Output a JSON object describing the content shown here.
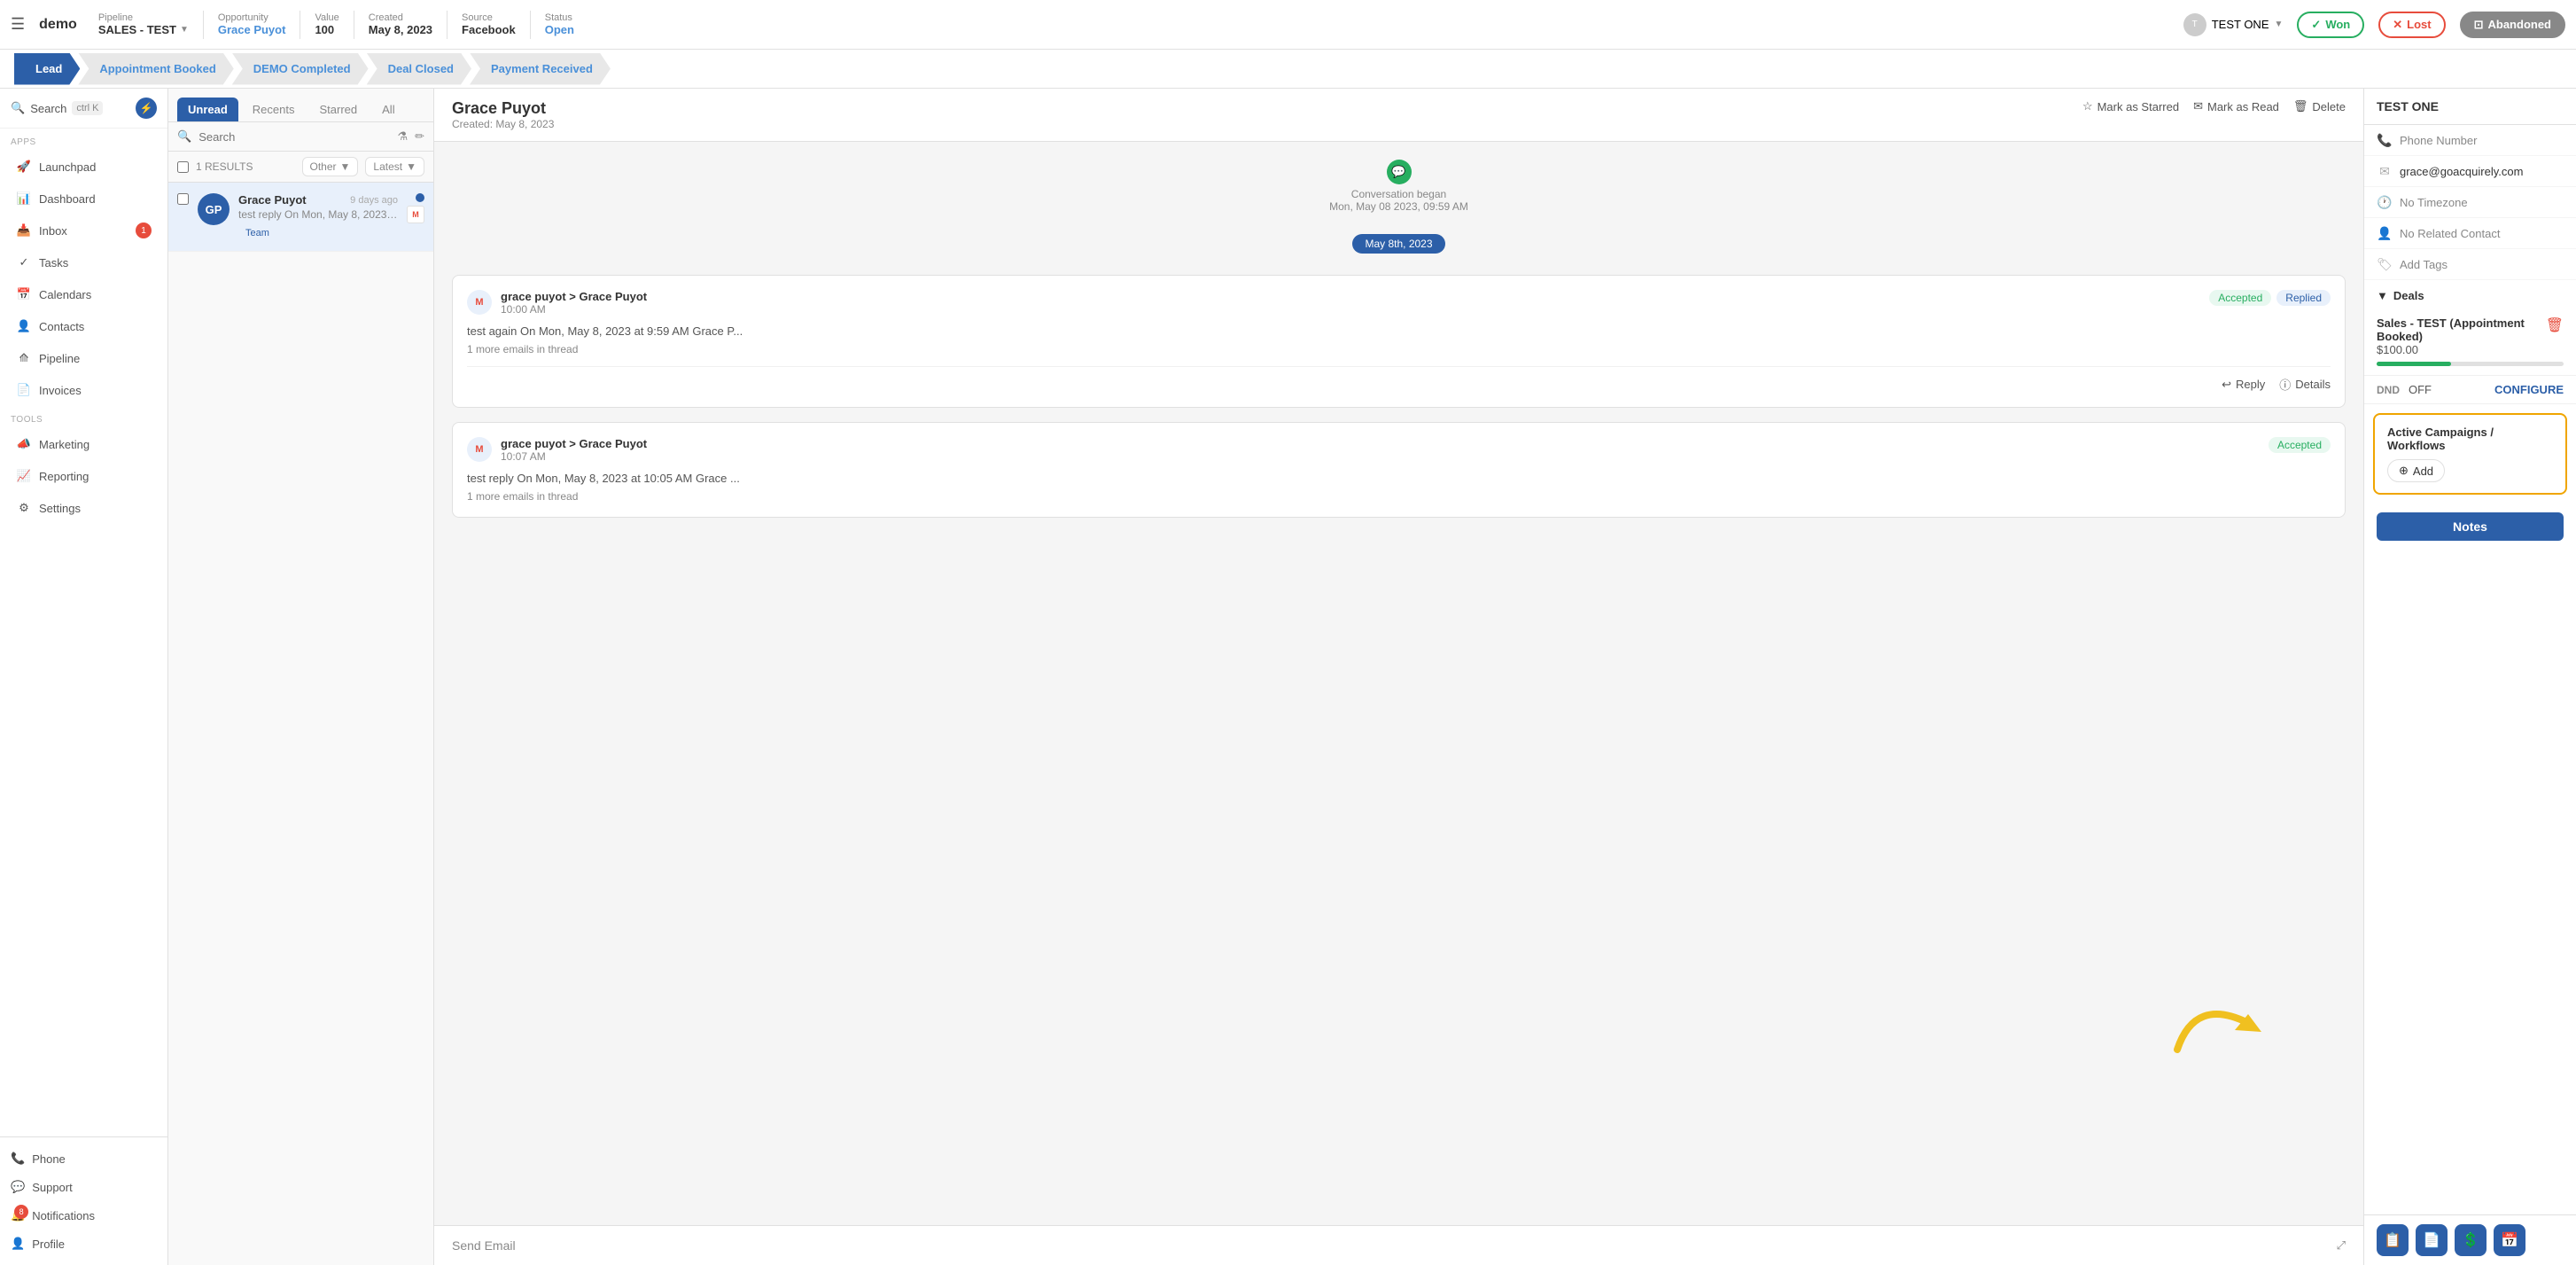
{
  "app": {
    "logo": "demo",
    "hamburger": "☰"
  },
  "topbar": {
    "pipeline_label": "Pipeline",
    "pipeline_value": "SALES - TEST",
    "opportunity_label": "Opportunity",
    "opportunity_value": "Grace Puyot",
    "value_label": "Value",
    "value_value": "100",
    "created_label": "Created",
    "created_value": "May 8, 2023",
    "source_label": "Source",
    "source_value": "Facebook",
    "status_label": "Status",
    "status_value": "Open",
    "user_name": "TEST ONE",
    "won_label": "Won",
    "lost_label": "Lost",
    "abandoned_label": "Abandoned"
  },
  "stages": [
    {
      "label": "Lead",
      "active": true
    },
    {
      "label": "Appointment Booked",
      "active": false
    },
    {
      "label": "DEMO Completed",
      "active": false
    },
    {
      "label": "Deal Closed",
      "active": false
    },
    {
      "label": "Payment Received",
      "active": false
    }
  ],
  "sidebar": {
    "search_label": "Search",
    "search_shortcut": "ctrl K",
    "sections": [
      {
        "label": "Apps",
        "items": [
          {
            "icon": "🚀",
            "label": "Launchpad"
          },
          {
            "icon": "📊",
            "label": "Dashboard"
          },
          {
            "icon": "📥",
            "label": "Inbox",
            "badge": "1"
          },
          {
            "icon": "✓",
            "label": "Tasks"
          },
          {
            "icon": "📅",
            "label": "Calendars"
          },
          {
            "icon": "👤",
            "label": "Contacts"
          },
          {
            "icon": "⟰",
            "label": "Pipeline"
          },
          {
            "icon": "📄",
            "label": "Invoices"
          }
        ]
      },
      {
        "label": "Tools",
        "items": [
          {
            "icon": "📣",
            "label": "Marketing"
          },
          {
            "icon": "📈",
            "label": "Reporting"
          },
          {
            "icon": "⚙",
            "label": "Settings"
          }
        ]
      }
    ],
    "bottom_items": [
      {
        "icon": "📞",
        "label": "Phone"
      },
      {
        "icon": "💬",
        "label": "Support"
      },
      {
        "icon": "🔔",
        "label": "Notifications",
        "badge": "8"
      },
      {
        "icon": "👤",
        "label": "Profile"
      }
    ]
  },
  "conv_list": {
    "tabs": [
      "Unread",
      "Recents",
      "Starred",
      "All"
    ],
    "active_tab": "Unread",
    "search_placeholder": "Search",
    "results_count": "1 RESULTS",
    "filter_other": "Other",
    "filter_latest": "Latest",
    "items": [
      {
        "initials": "GP",
        "name": "Grace Puyot",
        "time": "9 days ago",
        "preview": "test reply On Mon, May 8, 2023 at ...",
        "badge": "Team",
        "has_dot": true,
        "has_gmail": true
      }
    ]
  },
  "conv_view": {
    "contact_name": "Grace Puyot",
    "created": "Created: May 8, 2023",
    "mark_starred": "Mark as Starred",
    "mark_read": "Mark as Read",
    "delete": "Delete",
    "conv_started_text": "Conversation began",
    "conv_started_date": "Mon, May 08 2023, 09:59 AM",
    "date_badge": "May 8th, 2023",
    "messages": [
      {
        "from": "grace puyot > Grace Puyot",
        "time": "10:00 AM",
        "body": "test again On Mon, May 8, 2023 at 9:59 AM Grace P...",
        "more": "1 more emails in thread",
        "badges": [
          "Accepted",
          "Replied"
        ]
      },
      {
        "from": "grace puyot > Grace Puyot",
        "time": "10:07 AM",
        "body": "test reply On Mon, May 8, 2023 at 10:05 AM Grace ...",
        "more": "1 more emails in thread",
        "badges": [
          "Accepted"
        ]
      }
    ],
    "reply_label": "Reply",
    "details_label": "Details",
    "send_email_placeholder": "Send Email"
  },
  "right_panel": {
    "user_name": "TEST ONE",
    "phone_label": "Phone Number",
    "email_value": "grace@goacquirely.com",
    "timezone_label": "No Timezone",
    "related_contact_label": "No Related Contact",
    "add_tags_label": "Add Tags",
    "deals_header": "Deals",
    "deal_title": "Sales - TEST (Appointment Booked)",
    "deal_amount": "$100.00",
    "dnd_label": "DND",
    "dnd_value": "OFF",
    "configure_label": "CONFIGURE",
    "campaigns_title": "Active Campaigns / Workflows",
    "add_label": "Add",
    "notes_label": "Notes"
  }
}
